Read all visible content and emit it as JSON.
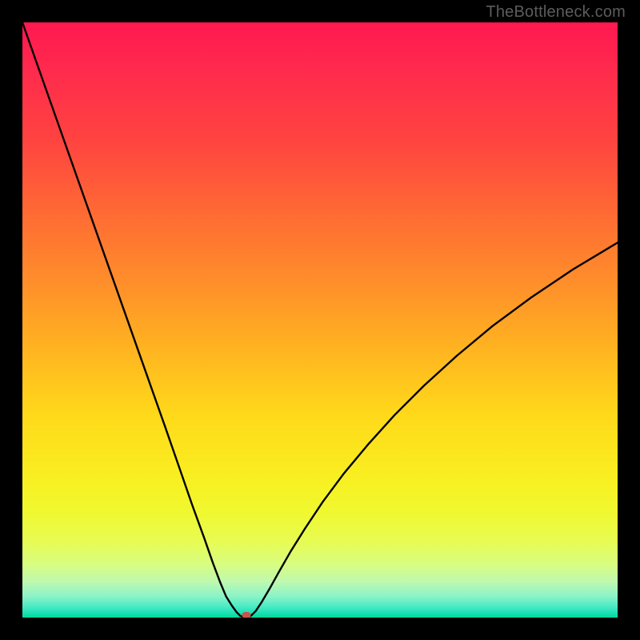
{
  "watermark": "TheBottleneck.com",
  "chart_data": {
    "type": "line",
    "title": "",
    "xlabel": "",
    "ylabel": "",
    "xlim": [
      0,
      100
    ],
    "ylim": [
      0,
      100
    ],
    "grid": false,
    "series": [
      {
        "name": "curve",
        "x": [
          0,
          3,
          6,
          9,
          12,
          15,
          18,
          21,
          24,
          26.5,
          28.5,
          30.5,
          32,
          33.2,
          34.2,
          35.2,
          36,
          36.6,
          37.2,
          37.7,
          38,
          38.5,
          39.2,
          40.2,
          41.5,
          43,
          45,
          47.5,
          50.5,
          54,
          58,
          62.5,
          67.5,
          73,
          79,
          85.5,
          92.5,
          100
        ],
        "y": [
          100,
          91.5,
          83,
          74.5,
          66,
          57.5,
          49,
          40.5,
          32,
          24.8,
          19,
          13.5,
          9.2,
          6,
          3.6,
          2,
          0.9,
          0.3,
          0.05,
          0,
          0.05,
          0.4,
          1.1,
          2.6,
          4.8,
          7.5,
          11,
          15,
          19.5,
          24.2,
          29,
          34,
          39,
          44,
          49,
          53.8,
          58.5,
          63
        ]
      }
    ],
    "marker": {
      "x": 37.7,
      "y": 0
    },
    "gradient_stops": [
      {
        "pos": 0,
        "color": "#ff1850"
      },
      {
        "pos": 8,
        "color": "#ff2a4d"
      },
      {
        "pos": 20,
        "color": "#ff4440"
      },
      {
        "pos": 32,
        "color": "#ff6a34"
      },
      {
        "pos": 44,
        "color": "#ff8f2a"
      },
      {
        "pos": 55,
        "color": "#ffb420"
      },
      {
        "pos": 66,
        "color": "#ffd91a"
      },
      {
        "pos": 76,
        "color": "#f9ee20"
      },
      {
        "pos": 82,
        "color": "#f0f82e"
      },
      {
        "pos": 87,
        "color": "#e8fb50"
      },
      {
        "pos": 91,
        "color": "#d8fd80"
      },
      {
        "pos": 94,
        "color": "#bef8b0"
      },
      {
        "pos": 96.5,
        "color": "#89f3c8"
      },
      {
        "pos": 98.3,
        "color": "#44e9c4"
      },
      {
        "pos": 99.3,
        "color": "#18e0b0"
      },
      {
        "pos": 100,
        "color": "#00d99a"
      }
    ]
  }
}
